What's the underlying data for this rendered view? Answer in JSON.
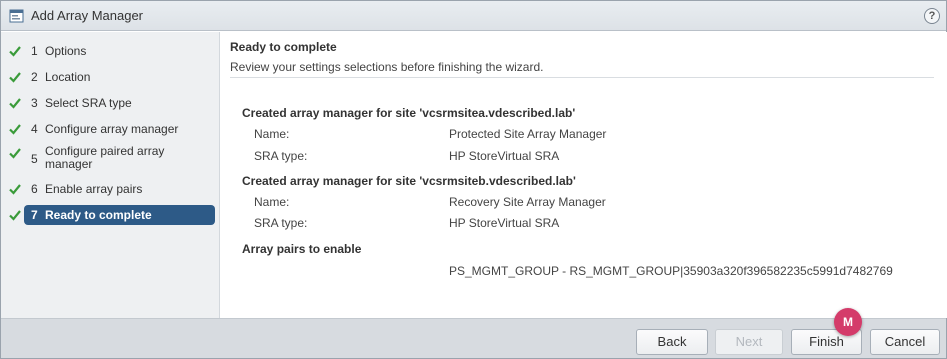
{
  "window": {
    "title": "Add Array Manager",
    "help": "?"
  },
  "steps": [
    {
      "num": "1",
      "label": "Options",
      "done": true
    },
    {
      "num": "2",
      "label": "Location",
      "done": true
    },
    {
      "num": "3",
      "label": "Select SRA type",
      "done": true
    },
    {
      "num": "4",
      "label": "Configure array manager",
      "done": true
    },
    {
      "num": "5",
      "label_line1": "Configure paired array",
      "label_line2": "manager",
      "done": true
    },
    {
      "num": "6",
      "label": "Enable array pairs",
      "done": true
    },
    {
      "num": "7",
      "label": "Ready to complete",
      "done": true,
      "active": true
    }
  ],
  "content": {
    "title": "Ready to complete",
    "subtitle": "Review your settings selections before finishing the wizard.",
    "section1": {
      "title": "Created array manager for site 'vcsrmsitea.vdescribed.lab'",
      "name_label": "Name:",
      "name_value": "Protected Site Array Manager",
      "sra_label": "SRA type:",
      "sra_value": "HP StoreVirtual SRA"
    },
    "section2": {
      "title": "Created array manager for site 'vcsrmsiteb.vdescribed.lab'",
      "name_label": "Name:",
      "name_value": "Recovery Site Array Manager",
      "sra_label": "SRA type:",
      "sra_value": "HP StoreVirtual SRA"
    },
    "section3": {
      "title": "Array pairs to enable",
      "value": "PS_MGMT_GROUP - RS_MGMT_GROUP|35903a320f396582235c5991d7482769"
    }
  },
  "footer": {
    "back": "Back",
    "next": "Next",
    "finish": "Finish",
    "cancel": "Cancel",
    "badge": "M"
  },
  "colors": {
    "accent": "#2d5a87",
    "check": "#3a9b3a",
    "badge": "#d43b6a"
  },
  "icons": {
    "title": "wizard-window-icon",
    "step_done": "checkmark-icon",
    "help": "help-icon"
  }
}
